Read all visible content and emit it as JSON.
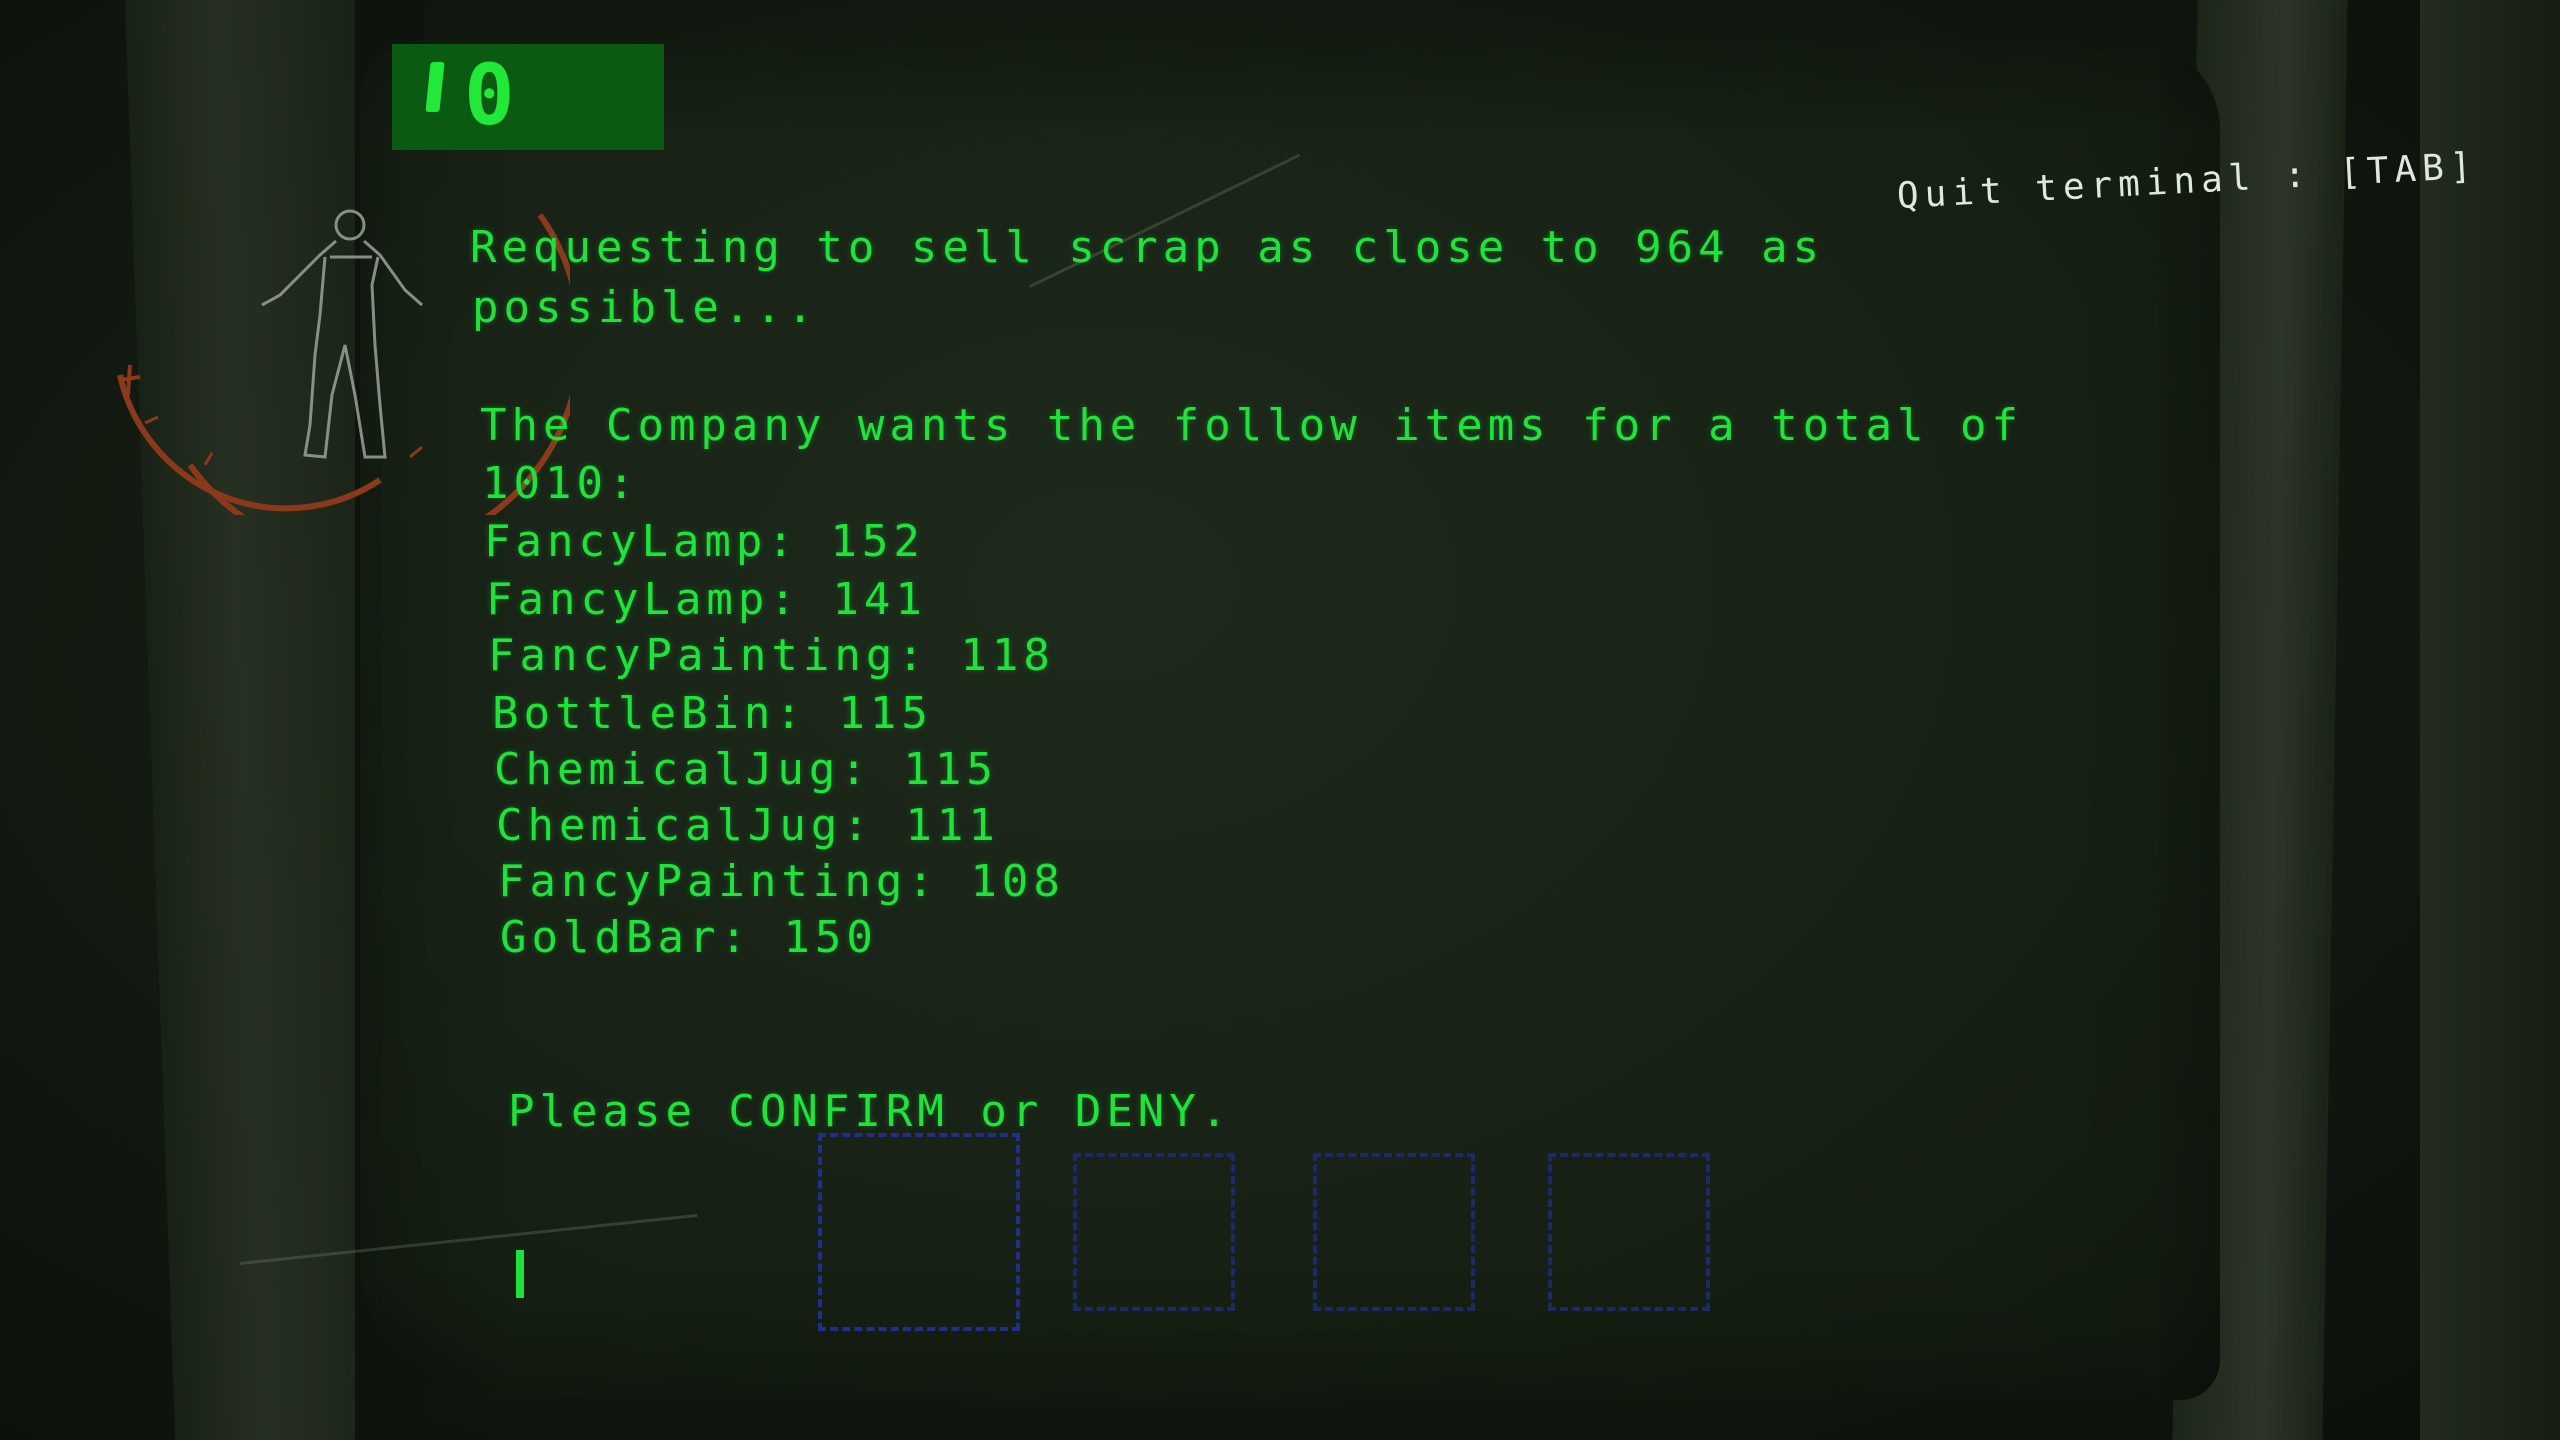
{
  "hud": {
    "credits": "0",
    "quit_hint": "Quit terminal : [TAB]"
  },
  "terminal": {
    "request_line_1": "Requesting to sell scrap as close to 964 as",
    "request_line_2": "possible...",
    "company_line_1": "The Company wants the follow items for a total of",
    "company_line_2": "1010:",
    "items": [
      "FancyLamp: 152",
      "FancyLamp: 141",
      "FancyPainting: 118",
      "BottleBin: 115",
      "ChemicalJug: 115",
      "ChemicalJug: 111",
      "FancyPainting: 108",
      "GoldBar: 150"
    ],
    "prompt": "Please CONFIRM or DENY."
  },
  "icons": {
    "player": "player-silhouette-icon",
    "compass": "compass-ring-icon"
  },
  "colors": {
    "terminal_text": "#1fe33a",
    "credits_bg": "#0a5a12",
    "slot_border": "#1c2a6a",
    "quit_text": "#dfe8dc",
    "compass_ring": "#8a3a1a"
  }
}
